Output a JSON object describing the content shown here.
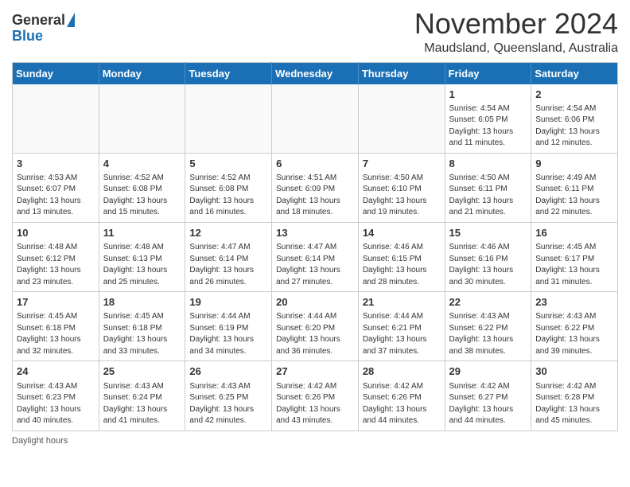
{
  "logo": {
    "general": "General",
    "blue": "Blue"
  },
  "title": "November 2024",
  "subtitle": "Maudsland, Queensland, Australia",
  "days_of_week": [
    "Sunday",
    "Monday",
    "Tuesday",
    "Wednesday",
    "Thursday",
    "Friday",
    "Saturday"
  ],
  "footer": "Daylight hours",
  "weeks": [
    [
      {
        "day": "",
        "detail": ""
      },
      {
        "day": "",
        "detail": ""
      },
      {
        "day": "",
        "detail": ""
      },
      {
        "day": "",
        "detail": ""
      },
      {
        "day": "",
        "detail": ""
      },
      {
        "day": "1",
        "detail": "Sunrise: 4:54 AM\nSunset: 6:05 PM\nDaylight: 13 hours and 11 minutes."
      },
      {
        "day": "2",
        "detail": "Sunrise: 4:54 AM\nSunset: 6:06 PM\nDaylight: 13 hours and 12 minutes."
      }
    ],
    [
      {
        "day": "3",
        "detail": "Sunrise: 4:53 AM\nSunset: 6:07 PM\nDaylight: 13 hours and 13 minutes."
      },
      {
        "day": "4",
        "detail": "Sunrise: 4:52 AM\nSunset: 6:08 PM\nDaylight: 13 hours and 15 minutes."
      },
      {
        "day": "5",
        "detail": "Sunrise: 4:52 AM\nSunset: 6:08 PM\nDaylight: 13 hours and 16 minutes."
      },
      {
        "day": "6",
        "detail": "Sunrise: 4:51 AM\nSunset: 6:09 PM\nDaylight: 13 hours and 18 minutes."
      },
      {
        "day": "7",
        "detail": "Sunrise: 4:50 AM\nSunset: 6:10 PM\nDaylight: 13 hours and 19 minutes."
      },
      {
        "day": "8",
        "detail": "Sunrise: 4:50 AM\nSunset: 6:11 PM\nDaylight: 13 hours and 21 minutes."
      },
      {
        "day": "9",
        "detail": "Sunrise: 4:49 AM\nSunset: 6:11 PM\nDaylight: 13 hours and 22 minutes."
      }
    ],
    [
      {
        "day": "10",
        "detail": "Sunrise: 4:48 AM\nSunset: 6:12 PM\nDaylight: 13 hours and 23 minutes."
      },
      {
        "day": "11",
        "detail": "Sunrise: 4:48 AM\nSunset: 6:13 PM\nDaylight: 13 hours and 25 minutes."
      },
      {
        "day": "12",
        "detail": "Sunrise: 4:47 AM\nSunset: 6:14 PM\nDaylight: 13 hours and 26 minutes."
      },
      {
        "day": "13",
        "detail": "Sunrise: 4:47 AM\nSunset: 6:14 PM\nDaylight: 13 hours and 27 minutes."
      },
      {
        "day": "14",
        "detail": "Sunrise: 4:46 AM\nSunset: 6:15 PM\nDaylight: 13 hours and 28 minutes."
      },
      {
        "day": "15",
        "detail": "Sunrise: 4:46 AM\nSunset: 6:16 PM\nDaylight: 13 hours and 30 minutes."
      },
      {
        "day": "16",
        "detail": "Sunrise: 4:45 AM\nSunset: 6:17 PM\nDaylight: 13 hours and 31 minutes."
      }
    ],
    [
      {
        "day": "17",
        "detail": "Sunrise: 4:45 AM\nSunset: 6:18 PM\nDaylight: 13 hours and 32 minutes."
      },
      {
        "day": "18",
        "detail": "Sunrise: 4:45 AM\nSunset: 6:18 PM\nDaylight: 13 hours and 33 minutes."
      },
      {
        "day": "19",
        "detail": "Sunrise: 4:44 AM\nSunset: 6:19 PM\nDaylight: 13 hours and 34 minutes."
      },
      {
        "day": "20",
        "detail": "Sunrise: 4:44 AM\nSunset: 6:20 PM\nDaylight: 13 hours and 36 minutes."
      },
      {
        "day": "21",
        "detail": "Sunrise: 4:44 AM\nSunset: 6:21 PM\nDaylight: 13 hours and 37 minutes."
      },
      {
        "day": "22",
        "detail": "Sunrise: 4:43 AM\nSunset: 6:22 PM\nDaylight: 13 hours and 38 minutes."
      },
      {
        "day": "23",
        "detail": "Sunrise: 4:43 AM\nSunset: 6:22 PM\nDaylight: 13 hours and 39 minutes."
      }
    ],
    [
      {
        "day": "24",
        "detail": "Sunrise: 4:43 AM\nSunset: 6:23 PM\nDaylight: 13 hours and 40 minutes."
      },
      {
        "day": "25",
        "detail": "Sunrise: 4:43 AM\nSunset: 6:24 PM\nDaylight: 13 hours and 41 minutes."
      },
      {
        "day": "26",
        "detail": "Sunrise: 4:43 AM\nSunset: 6:25 PM\nDaylight: 13 hours and 42 minutes."
      },
      {
        "day": "27",
        "detail": "Sunrise: 4:42 AM\nSunset: 6:26 PM\nDaylight: 13 hours and 43 minutes."
      },
      {
        "day": "28",
        "detail": "Sunrise: 4:42 AM\nSunset: 6:26 PM\nDaylight: 13 hours and 44 minutes."
      },
      {
        "day": "29",
        "detail": "Sunrise: 4:42 AM\nSunset: 6:27 PM\nDaylight: 13 hours and 44 minutes."
      },
      {
        "day": "30",
        "detail": "Sunrise: 4:42 AM\nSunset: 6:28 PM\nDaylight: 13 hours and 45 minutes."
      }
    ]
  ]
}
